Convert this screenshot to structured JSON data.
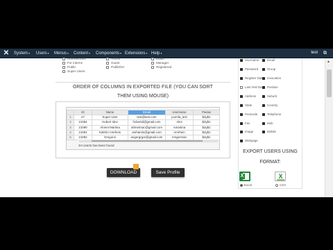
{
  "menubar": {
    "items": [
      "System",
      "Users",
      "Menus",
      "Content",
      "Components",
      "Extensions",
      "Help"
    ],
    "user": "test"
  },
  "groups": {
    "col1": [
      {
        "label": "Administrator",
        "checked": false
      },
      {
        "label": "For interns",
        "checked": false
      },
      {
        "label": "Public",
        "checked": false
      },
      {
        "label": "Super Users",
        "checked": false
      }
    ],
    "col2": [
      {
        "label": "Author",
        "checked": false
      },
      {
        "label": "Guest",
        "checked": false
      },
      {
        "label": "Publisher",
        "checked": false
      }
    ],
    "col3": [
      {
        "label": "Editor",
        "checked": false
      },
      {
        "label": "Manager",
        "checked": false
      },
      {
        "label": "Registered",
        "checked": false
      }
    ]
  },
  "order": {
    "title_line1": "ORDER OF COLUMNS IN EXPORTED FILE (YOU CAN SORT",
    "title_line2": "THEM USING MOUSE)",
    "headers": [
      "",
      "ID",
      "Name",
      "Email",
      "Username",
      "Passw"
    ],
    "rows": [
      [
        "1",
        "47",
        "Super User",
        "test@test.com",
        "joomla_test",
        "$2y$1"
      ],
      [
        "2",
        "21084",
        "Hubert Idev",
        "hcbertid@gmail.com",
        "Alex",
        "$2y$1"
      ],
      [
        "3",
        "21090",
        "Ahmet Martina",
        "ahmetmac@gmail.com",
        "Amartina",
        "$2y$1"
      ],
      [
        "4",
        "21091",
        "Kathrin Amrhein",
        "amhamin@gmail.com",
        "Amrhein",
        "$2y$1"
      ],
      [
        "5",
        "21092",
        "Gregorio",
        "angergrgor@gmail.com",
        "mngerman",
        "$2y$1"
      ]
    ],
    "status": "34 Userts has been found"
  },
  "buttons": {
    "download": "DOWNLOAD",
    "save": "Save Profile"
  },
  "fields": {
    "left": [
      {
        "label": "",
        "checked": true
      },
      {
        "label": "Username",
        "checked": true
      },
      {
        "label": "Password",
        "checked": true
      },
      {
        "label": "Register Date",
        "checked": true
      },
      {
        "label": "Last Visit Date",
        "checked": false
      },
      {
        "label": "Address",
        "checked": true
      },
      {
        "label": "State",
        "checked": true
      },
      {
        "label": "Postcode",
        "checked": true
      },
      {
        "label": "Fax",
        "checked": true
      },
      {
        "label": "Image",
        "checked": true
      },
      {
        "label": "Webpage",
        "checked": true
      }
    ],
    "right": [
      {
        "label": "",
        "checked": true
      },
      {
        "label": "Email",
        "checked": true
      },
      {
        "label": "Group",
        "checked": true
      },
      {
        "label": "Invocation",
        "checked": true
      },
      {
        "label": "Position",
        "checked": true
      },
      {
        "label": "Suburb",
        "checked": true
      },
      {
        "label": "Country",
        "checked": true
      },
      {
        "label": "Telephone",
        "checked": true
      },
      {
        "label": "Mob",
        "checked": true
      },
      {
        "label": "Mobile",
        "checked": true
      }
    ]
  },
  "export": {
    "title_line1": "EXPORT USERS USING",
    "title_line2": "FORMAT:",
    "formats": [
      {
        "label": "Excel",
        "selected": true
      },
      {
        "label": "CSV",
        "selected": false
      }
    ]
  },
  "colors": {
    "menubar": "#1d2f40",
    "selected_header": "#5d9fe0",
    "button": "#303030",
    "excel_green": "#1f8a3a"
  }
}
